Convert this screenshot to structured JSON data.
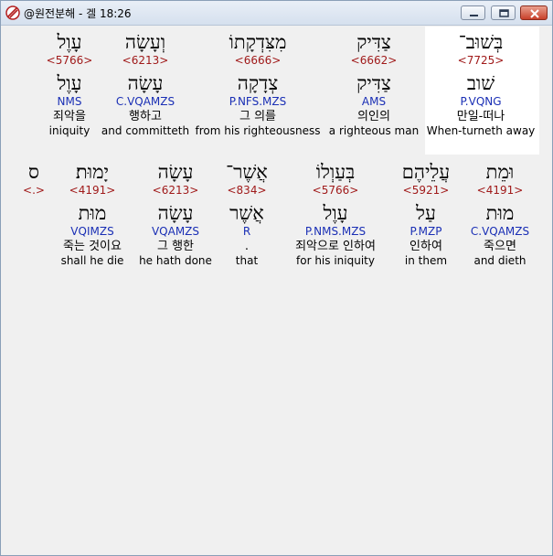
{
  "window": {
    "title": "@원전분해 - 겔 18:26",
    "icon": "app-logo-icon"
  },
  "row1": [
    {
      "hebrew": "בְּשׁוּב־",
      "strong": "<7725>",
      "lemma": "שׁוב",
      "morph": "P.VQNG",
      "korean": "만일-떠나",
      "english": "When-turneth away",
      "highlight": true
    },
    {
      "hebrew": "צַדִּיק",
      "strong": "<6662>",
      "lemma": "צַדִּיק",
      "morph": "AMS",
      "korean": "의인의",
      "english": "a righteous man"
    },
    {
      "hebrew": "מִצִּדְקָתוֹ",
      "strong": "<6666>",
      "lemma": "צְדָקָה",
      "morph": "P.NFS.MZS",
      "korean": "그 의를",
      "english": "from his righteousness"
    },
    {
      "hebrew": "וְעָשָׂה",
      "strong": "<6213>",
      "lemma": "עָשָׂה",
      "morph": "C.VQAMZS",
      "korean": "행하고",
      "english": "and committeth"
    },
    {
      "hebrew": "עָוֶל",
      "strong": "<5766>",
      "lemma": "עָוֶל",
      "morph": "NMS",
      "korean": "죄악을",
      "english": "iniquity"
    }
  ],
  "row2": [
    {
      "hebrew": "וּמֵת",
      "strong": "<4191>",
      "lemma": "מוּת",
      "morph": "C.VQAMZS",
      "korean": "죽으면",
      "english": "and dieth"
    },
    {
      "hebrew": "עֲלֵיהֶם",
      "strong": "<5921>",
      "lemma": "עַל",
      "morph": "P.MZP",
      "korean": "인하여",
      "english": "in them"
    },
    {
      "hebrew": "בְּעַוְלוֹ",
      "strong": "<5766>",
      "lemma": "עָוֶל",
      "morph": "P.NMS.MZS",
      "korean": "죄악으로 인하여",
      "english": "for his iniquity"
    },
    {
      "hebrew": "אֲשֶׁר־",
      "strong": "<834>",
      "lemma": "אֲשֶׁר",
      "morph": "R",
      "korean": ".",
      "english": "that"
    },
    {
      "hebrew": "עָשָׂה",
      "strong": "<6213>",
      "lemma": "עָשָׂה",
      "morph": "VQAMZS",
      "korean": "그 행한",
      "english": "he hath done"
    },
    {
      "hebrew": "יָמוּת׃",
      "strong": "<4191>",
      "lemma": "מוּת",
      "morph": "VQIMZS",
      "korean": "죽는 것이요",
      "english": "shall he die"
    },
    {
      "hebrew": "ס",
      "strong": "<.>",
      "lemma": "",
      "morph": "",
      "korean": "",
      "english": ""
    }
  ],
  "colors": {
    "strong": "#a01a1a",
    "morph": "#1a2fb5",
    "highlight": "#ffffff",
    "background": "#f0f0f0"
  }
}
